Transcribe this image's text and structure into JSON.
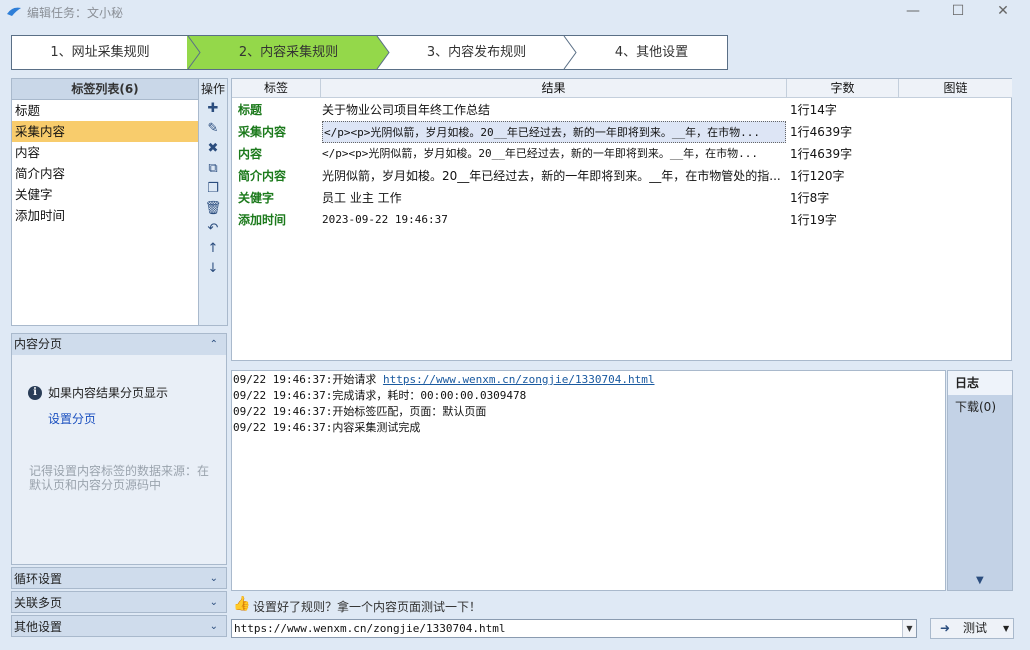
{
  "window": {
    "title": "编辑任务：文小秘",
    "minimize": "—",
    "maximize": "☐",
    "close": "✕"
  },
  "steps": [
    {
      "label": "1、网址采集规则"
    },
    {
      "label": "2、内容采集规则"
    },
    {
      "label": "3、内容发布规则"
    },
    {
      "label": "4、其他设置"
    }
  ],
  "tag_list": {
    "header": "标签列表(6)",
    "items": [
      "标题",
      "采集内容",
      "内容",
      "简介内容",
      "关健字",
      "添加时间"
    ],
    "selected_index": 1
  },
  "ops": {
    "label": "操作"
  },
  "grid": {
    "columns": [
      "标签",
      "结果",
      "字数",
      "图链"
    ],
    "rows": [
      {
        "label": "标题",
        "result": "关于物业公司项目年终工作总结",
        "count": "1行14字"
      },
      {
        "label": "采集内容",
        "result": "</p><p>光阴似箭，岁月如梭。20__年已经过去，新的一年即将到来。__年，在市物...",
        "count": "1行4639字"
      },
      {
        "label": "内容",
        "result": "</p><p>光阴似箭，岁月如梭。20__年已经过去，新的一年即将到来。__年，在市物...",
        "count": "1行4639字"
      },
      {
        "label": "简介内容",
        "result": "光阴似箭，岁月如梭。20__年已经过去，新的一年即将到来。__年，在市物管处的指...",
        "count": "1行120字"
      },
      {
        "label": "关健字",
        "result": "员工 业主 工作",
        "count": "1行8字"
      },
      {
        "label": "添加时间",
        "result": "2023-09-22 19:46:37",
        "count": "1行19字"
      }
    ]
  },
  "pagination": {
    "header": "内容分页",
    "info": "如果内容结果分页显示",
    "link": "设置分页",
    "hint": "记得设置内容标签的数据来源：在默认页和内容分页源码中"
  },
  "sections": {
    "loop": "循环设置",
    "multi": "关联多页",
    "other": "其他设置"
  },
  "log": {
    "lines": [
      {
        "text": "09/22 19:46:37:开始请求 ",
        "link": "https://www.wenxm.cn/zongjie/1330704.html"
      },
      {
        "text": "09/22 19:46:37:完成请求，耗时：00:00:00.0309478",
        "link": ""
      },
      {
        "text": "09/22 19:46:37:开始标签匹配，页面：默认页面",
        "link": ""
      },
      {
        "text": "09/22 19:46:37:内容采集测试完成",
        "link": ""
      }
    ]
  },
  "side_tabs": {
    "log": "日志",
    "download": "下载(0)"
  },
  "test": {
    "prompt": "设置好了规则？拿一个内容页面测试一下！",
    "url": "https://www.wenxm.cn/zongjie/1330704.html",
    "button": "测试"
  }
}
